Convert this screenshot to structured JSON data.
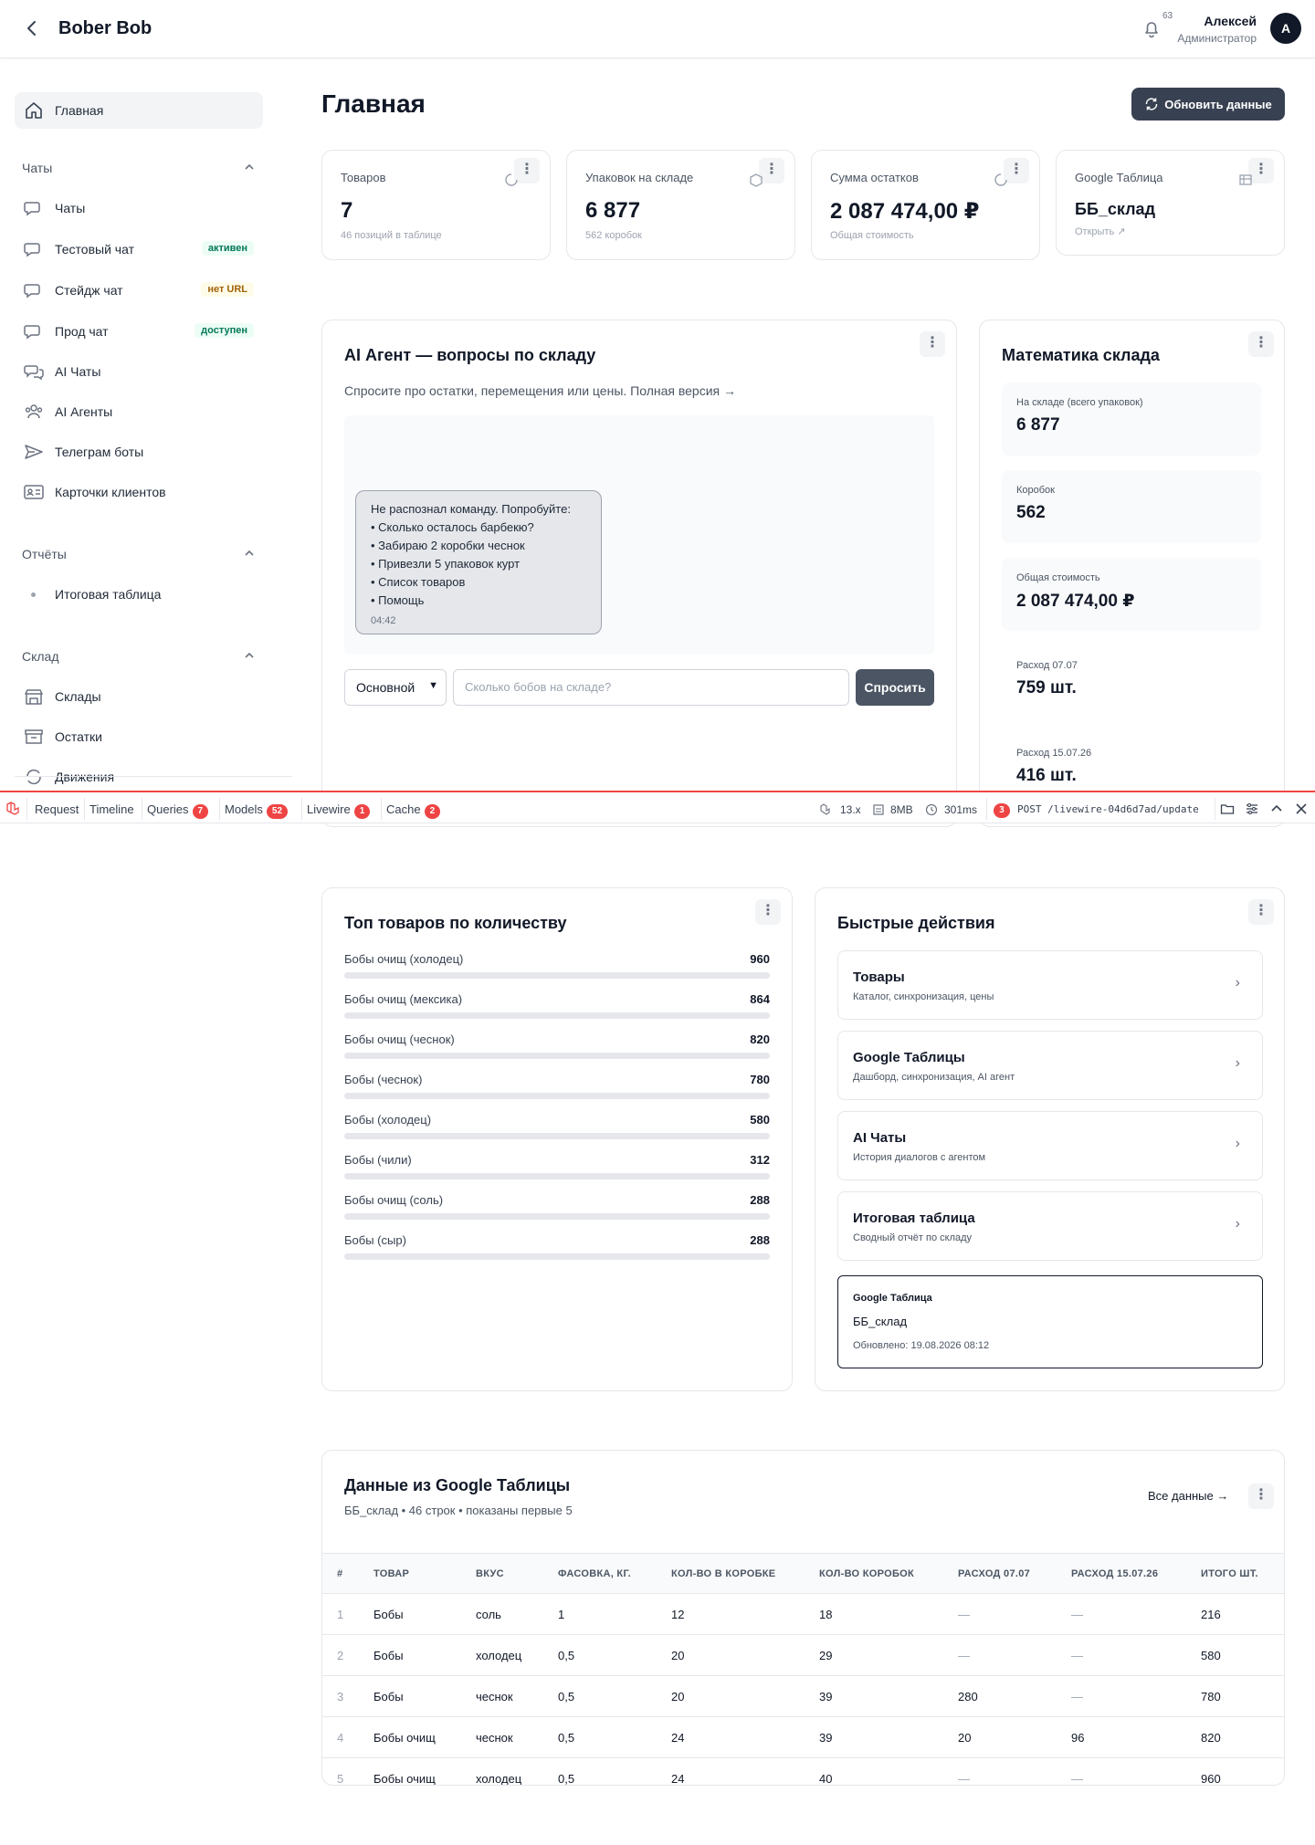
{
  "header": {
    "brand": "Bober Bob",
    "notifications": "63",
    "user_name": "Алексей",
    "user_role": "Администратор",
    "avatar_letter": "A"
  },
  "sidebar": {
    "home": "Главная",
    "group_chats": "Чаты",
    "chats": [
      {
        "label": "Чаты",
        "badge": ""
      },
      {
        "label": "Тестовый чат",
        "badge": "активен"
      },
      {
        "label": "Стейдж чат",
        "badge": "нет URL"
      },
      {
        "label": "Прод чат",
        "badge": "доступен"
      },
      {
        "label": "AI Чаты",
        "badge": ""
      },
      {
        "label": "AI Агенты",
        "badge": ""
      },
      {
        "label": "Телеграм боты",
        "badge": ""
      },
      {
        "label": "Карточки клиентов",
        "badge": ""
      }
    ],
    "group_reports": "Отчёты",
    "reports": [
      "Итоговая таблица"
    ],
    "group_warehouse": "Склад",
    "warehouse": [
      "Склады",
      "Остатки",
      "Движения"
    ]
  },
  "page": {
    "title": "Главная",
    "refresh_label": "Обновить данные"
  },
  "stats": [
    {
      "label": "Товаров",
      "value": "7",
      "sub": "46 позиций в таблице"
    },
    {
      "label": "Упаковок на складе",
      "value": "6 877",
      "sub": "562 коробок"
    },
    {
      "label": "Сумма остатков",
      "value": "2 087 474,00 ₽",
      "sub": "Общая стоимость"
    },
    {
      "label": "Google Таблица",
      "value": "ББ_склад",
      "sub": "Открыть ↗"
    }
  ],
  "agent": {
    "title": "AI Агент — вопросы по складу",
    "subtitle": "Спросите про остатки, перемещения или цены. Полная версия →",
    "message_lines": [
      "Не распознал команду. Попробуйте:",
      "• Сколько осталось барбекю?",
      "• Забираю 2 коробки чеснок",
      "• Привезли 5 упаковок курт",
      "• Список товаров",
      "• Помощь"
    ],
    "message_time": "04:42",
    "mode": "Основной",
    "input_placeholder": "Сколько бобов на складе?",
    "ask_label": "Спросить"
  },
  "math": {
    "title": "Математика склада",
    "items": [
      {
        "label": "На складе (всего упаковок)",
        "value": "6 877"
      },
      {
        "label": "Коробок",
        "value": "562"
      },
      {
        "label": "Общая стоимость",
        "value": "2 087 474,00 ₽"
      },
      {
        "label": "Расход 07.07",
        "value": "759 шт."
      },
      {
        "label": "Расход 15.07.26",
        "value": "416 шт."
      }
    ]
  },
  "debugbar": {
    "tabs": [
      {
        "label": "Request",
        "count": ""
      },
      {
        "label": "Timeline",
        "count": ""
      },
      {
        "label": "Queries",
        "count": "7"
      },
      {
        "label": "Models",
        "count": "52"
      },
      {
        "label": "Livewire",
        "count": "1"
      },
      {
        "label": "Cache",
        "count": "2"
      }
    ],
    "version": "13.x",
    "memory": "8MB",
    "time": "301ms",
    "req_count": "3",
    "request": "POST /livewire-04d6d7ad/update"
  },
  "top_products": {
    "title": "Топ товаров по количеству",
    "max": 960,
    "items": [
      {
        "name": "Бобы очищ (холодец)",
        "qty": "960"
      },
      {
        "name": "Бобы очищ (мексика)",
        "qty": "864"
      },
      {
        "name": "Бобы очищ (чеснок)",
        "qty": "820"
      },
      {
        "name": "Бобы (чеснок)",
        "qty": "780"
      },
      {
        "name": "Бобы (холодец)",
        "qty": "580"
      },
      {
        "name": "Бобы (чили)",
        "qty": "312"
      },
      {
        "name": "Бобы очищ (соль)",
        "qty": "288"
      },
      {
        "name": "Бобы (сыр)",
        "qty": "288"
      }
    ]
  },
  "quick": {
    "title": "Быстрые действия",
    "items": [
      {
        "title": "Товары",
        "sub": "Каталог, синхронизация, цены"
      },
      {
        "title": "Google Таблицы",
        "sub": "Дашборд, синхронизация, AI агент"
      },
      {
        "title": "AI Чаты",
        "sub": "История диалогов с агентом"
      },
      {
        "title": "Итоговая таблица",
        "sub": "Сводный отчёт по складу"
      }
    ],
    "sheet_label": "Google Таблица",
    "sheet_name": "ББ_склад",
    "sheet_updated": "Обновлено: 19.08.2026 08:12"
  },
  "gtable": {
    "title": "Данные из Google Таблицы",
    "subtitle": "ББ_склад • 46 строк • показаны первые 5",
    "all_label": "Все данные →",
    "headers": [
      "#",
      "Товар",
      "Вкус",
      "Фасовка, кг.",
      "Кол-во в коробке",
      "Кол-во коробок",
      "Расход 07.07",
      "Расход 15.07.26",
      "Итого шт."
    ],
    "rows": [
      [
        "1",
        "Бобы",
        "соль",
        "1",
        "12",
        "18",
        "—",
        "—",
        "216"
      ],
      [
        "2",
        "Бобы",
        "холодец",
        "0,5",
        "20",
        "29",
        "—",
        "—",
        "580"
      ],
      [
        "3",
        "Бобы",
        "чеснок",
        "0,5",
        "20",
        "39",
        "280",
        "—",
        "780"
      ],
      [
        "4",
        "Бобы очищ",
        "чеснок",
        "0,5",
        "24",
        "39",
        "20",
        "96",
        "820"
      ],
      [
        "5",
        "Бобы очищ",
        "холодец",
        "0,5",
        "24",
        "40",
        "—",
        "—",
        "960"
      ]
    ]
  }
}
